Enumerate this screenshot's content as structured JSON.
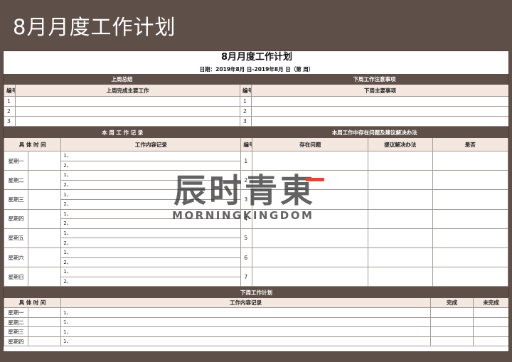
{
  "banner_title": "8月月度工作计划",
  "doc": {
    "title": "8月月度工作计划",
    "date_line": "日期：2019年8月  日-2019年8月  日（第  周）"
  },
  "last_week": {
    "header": "上周总结",
    "col_no": "编号",
    "col_main": "上周完成主要工作",
    "rows": [
      "1",
      "2",
      "3"
    ]
  },
  "next_week_notes": {
    "header": "下周工作注意事项",
    "col_no": "编号",
    "col_main": "下周主要事项",
    "rows": [
      "1",
      "2",
      "3"
    ]
  },
  "week_record": {
    "header": "本 周 工 作 记 录",
    "col_time": "具 体 时 间",
    "col_content": "工作内容记录",
    "days": [
      "星期一",
      "星期二",
      "星期三",
      "星期四",
      "星期五",
      "星期六",
      "星期日"
    ],
    "line1": "1、",
    "line2": "2、"
  },
  "issues": {
    "header": "本周工作中存在问题及建议解决办法",
    "col_no": "编号",
    "col_problem": "存在问题",
    "col_solution": "提议解决办法",
    "col_yesno": "是否",
    "rows": [
      "1",
      "2",
      "3",
      "4",
      "5",
      "6",
      "7"
    ]
  },
  "next_plan": {
    "header": "下周工作计划",
    "col_time": "具 体 时 间",
    "col_content": "工作内容记录",
    "col_done": "完成",
    "col_undone": "未完成",
    "days": [
      "星期一",
      "星期二",
      "星期三",
      "星期四"
    ],
    "item": "1、"
  },
  "watermark": {
    "cn": "辰时青東",
    "en": "MORNINGKINGDOM"
  }
}
